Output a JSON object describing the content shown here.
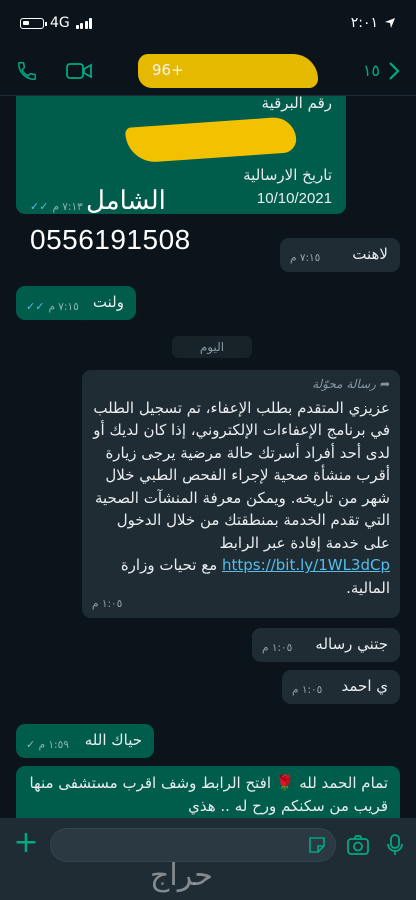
{
  "status_bar": {
    "time": "٢:٠١",
    "network": "4G"
  },
  "header": {
    "back_count": "١٥",
    "contact_partial": "96+"
  },
  "messages": {
    "card": {
      "plate_label": "رقم البرقية",
      "send_date_label": "تاريخ الارسالية",
      "send_date": "10/10/2021",
      "name": "الشامل",
      "time": "٧:١٣ م",
      "phone": "0556191508"
    },
    "m1": {
      "text": "لاهنت",
      "time": "٧:١٥ م"
    },
    "m2": {
      "text": "ولنت",
      "time": "٧:١٥ م"
    },
    "date_chip": "اليوم",
    "m3": {
      "forwarded_label": "رسالة محوّلة",
      "text_before_link": "عزيزي المتقدم بطلب الإعفاء، تم تسجيل الطلب في برنامج الإعفاءات الإلكتروني، إذا كان لديك أو لدى أحد أفراد أسرتك حالة مرضية يرجى زيارة أقرب منشأة صحية لإجراء الفحص الطبي خلال شهر من تاريخه. ويمكن معرفة المنشآت الصحية التي تقدم الخدمة بمنطقتك من خلال الدخول على خدمة إفادة عبر الرابط",
      "link": "https://bit.ly/1WL3dCp",
      "text_after_link": "مع تحيات وزارة المالية.",
      "time": "١:٠٥ م"
    },
    "m4": {
      "text": "جتني رساله",
      "time": "١:٠٥ م"
    },
    "m5": {
      "text": "ي احمد",
      "time": "١:٠٥ م"
    },
    "m6": {
      "text": "حياك الله",
      "time": "١:٥٩ م"
    },
    "m7": {
      "text": "تمام الحمد لله 🌹 افتح الرابط وشف اقرب مستشفى منها قريب من سكنكم ورح له .. هذي"
    }
  },
  "input": {
    "placeholder": ""
  },
  "watermark": "حراج",
  "colors": {
    "accent": "#00a884",
    "outgoing": "#005c4b",
    "incoming": "#202c33",
    "link": "#53bdeb"
  }
}
